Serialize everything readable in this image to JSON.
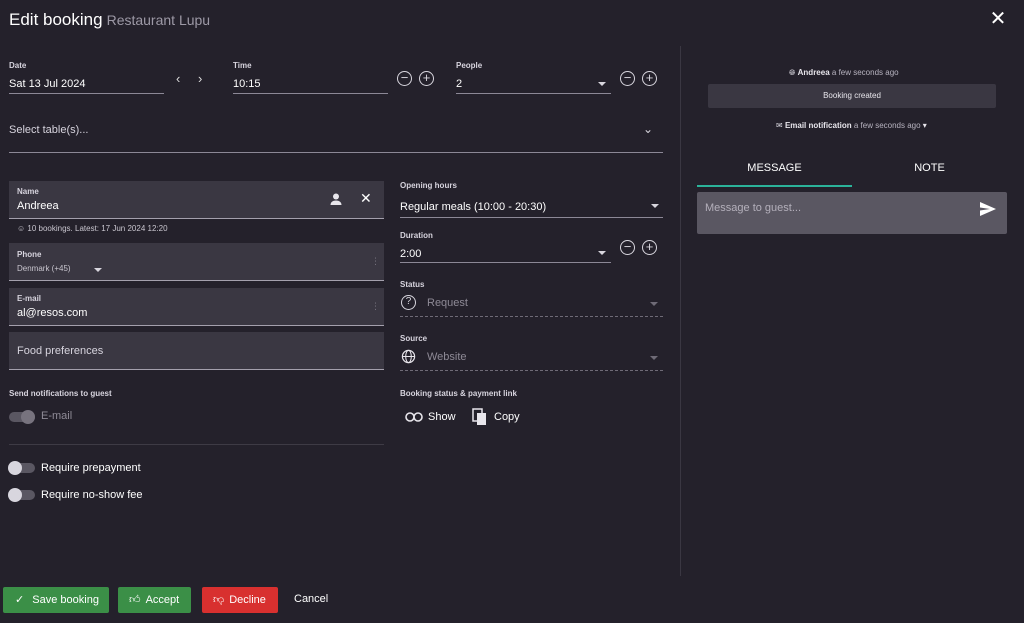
{
  "header": {
    "title": "Edit booking",
    "subtitle": "Restaurant Lupu"
  },
  "date": {
    "label": "Date",
    "value": "Sat 13 Jul 2024"
  },
  "time": {
    "label": "Time",
    "value": "10:15"
  },
  "people": {
    "label": "People",
    "value": "2"
  },
  "tables": {
    "placeholder": "Select table(s)..."
  },
  "name": {
    "label": "Name",
    "value": "Andreea",
    "stats": "10 bookings. Latest: 17 Jun 2024 12:20"
  },
  "phone": {
    "label": "Phone",
    "country": "Denmark (+45)"
  },
  "email": {
    "label": "E-mail",
    "value": "al@resos.com"
  },
  "food": {
    "placeholder": "Food preferences"
  },
  "notifications": {
    "label": "Send notifications to guest",
    "email_toggle": "E-mail"
  },
  "prepayment": {
    "label": "Require prepayment"
  },
  "noshow": {
    "label": "Require no-show fee"
  },
  "opening": {
    "label": "Opening hours",
    "value": "Regular meals (10:00 - 20:30)"
  },
  "duration": {
    "label": "Duration",
    "value": "2:00"
  },
  "status": {
    "label": "Status",
    "value": "Request"
  },
  "source": {
    "label": "Source",
    "value": "Website"
  },
  "payment_link": {
    "label": "Booking status & payment link",
    "show": "Show",
    "copy": "Copy"
  },
  "actions": {
    "save": "Save booking",
    "accept": "Accept",
    "decline": "Decline",
    "cancel": "Cancel"
  },
  "activity": {
    "user": "Andreea",
    "user_time": "a few seconds ago",
    "event": "Booking created",
    "email_label": "Email notification",
    "email_time": "a few seconds ago"
  },
  "tabs": {
    "message": "MESSAGE",
    "note": "NOTE"
  },
  "message": {
    "placeholder": "Message to guest..."
  },
  "colors": {
    "background": "#24212b",
    "green": "#3b8f47",
    "red": "#d8302f",
    "accent": "#2bb39a"
  }
}
